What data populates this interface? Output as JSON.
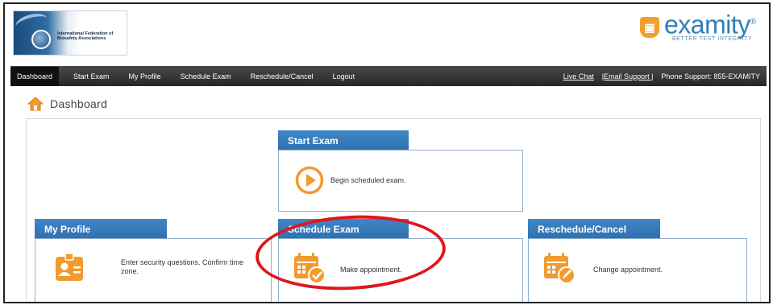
{
  "header": {
    "org_name": "International Federation of Biosafety Associations",
    "brand_name": "examity",
    "brand_registered": "®",
    "brand_tagline": "BETTER TEST INTEGRITY"
  },
  "nav": {
    "items": [
      {
        "label": "Dashboard"
      },
      {
        "label": "Start Exam"
      },
      {
        "label": "My Profile"
      },
      {
        "label": "Schedule Exam"
      },
      {
        "label": "Reschedule/Cancel"
      },
      {
        "label": "Logout"
      }
    ],
    "live_chat": "Live Chat",
    "email_support": "|Email Support |",
    "phone_support": "Phone Support: 855-EXAMITY"
  },
  "page": {
    "title": "Dashboard"
  },
  "cards": {
    "start_exam": {
      "title": "Start Exam",
      "description": "Begin scheduled exam."
    },
    "my_profile": {
      "title": "My Profile",
      "description": "Enter security questions. Confirm time zone."
    },
    "schedule_exam": {
      "title": "Schedule Exam",
      "description": "Make appointment."
    },
    "reschedule": {
      "title": "Reschedule/Cancel",
      "description": "Change appointment."
    }
  },
  "colors": {
    "card_header_blue": "#3a7dbf",
    "icon_orange": "#f29a2e",
    "highlight_red": "#e0161d",
    "nav_dark": "#333333"
  }
}
